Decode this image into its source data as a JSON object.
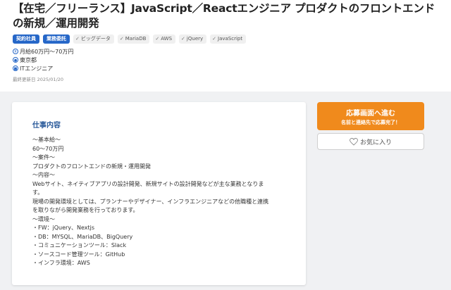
{
  "header": {
    "title_line1": "【在宅／フリーランス】JavaScript／Reactエンジニア プロダクトのフロントエンド",
    "title_line2": "の新規／運用開発",
    "contract_tags": [
      "契約社員",
      "業務委託"
    ],
    "skill_tags": [
      "ビッグデータ",
      "MariaDB",
      "AWS",
      "jQuery",
      "JavaScript"
    ],
    "salary": "月給60万円〜70万円",
    "location": "東京都",
    "category": "ITエンジニア",
    "updated": "最終更新日  2025/01/20"
  },
  "job": {
    "heading": "仕事内容",
    "lines": [
      "〜基本給〜",
      "60〜70万円",
      "〜案件〜",
      "プロダクトのフロントエンドの新規・運用開発",
      "〜内容〜",
      "Webサイト、ネイティブアプリの設計開発、新規サイトの設計開発などが主な業務となりま",
      "す。",
      "現場の開発環境としては、プランナーやデザイナー、インフラエンジニアなどの他職種と連携",
      "を取りながら開発業務を行っております。",
      "〜環境〜",
      "・FW：jQuery、Nextjs",
      "・DB：MYSQL、MariaDB、BigQuery",
      "・コミュニケーションツール：Slack",
      "・ソースコード管理ツール：GitHub",
      "・インフラ環境：AWS"
    ]
  },
  "actions": {
    "apply_label": "応募画面へ進む",
    "apply_sub": "名前と連絡先で応募完了！",
    "favorite_label": "お気に入り"
  },
  "colors": {
    "accent": "#2667c8",
    "apply": "#f08a1c",
    "heading": "#2a5a9a"
  }
}
